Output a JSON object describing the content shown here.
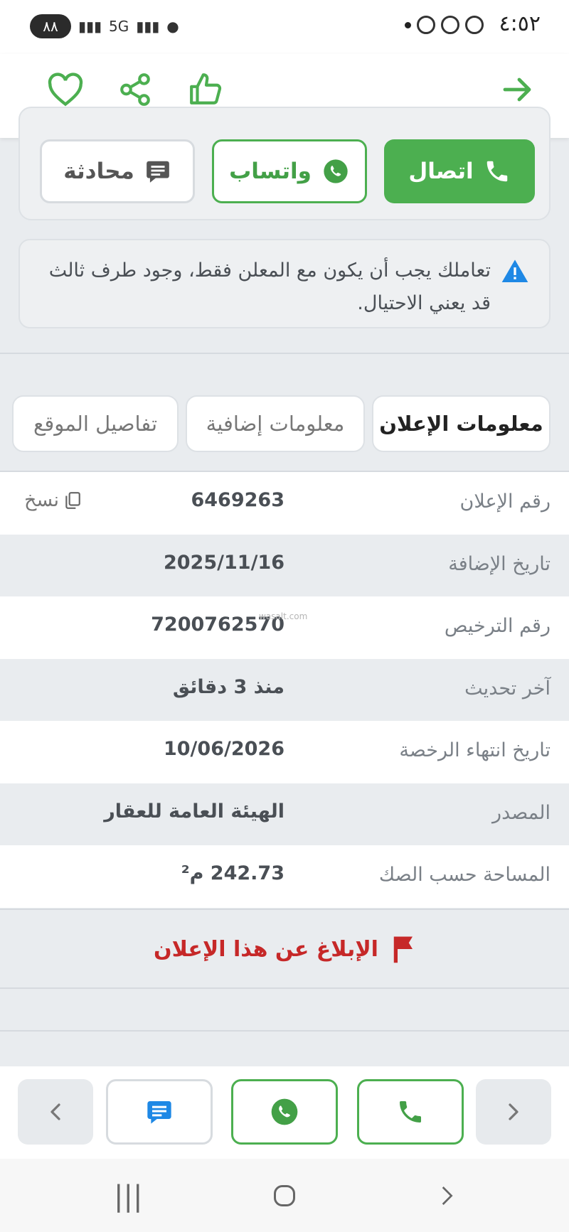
{
  "status_bar": {
    "time": "٤:٥٢",
    "battery": "٨٨",
    "network": "5G"
  },
  "toolbar": {
    "icons": [
      "arrow-right-icon",
      "thumbs-up-icon",
      "share-icon",
      "heart-icon"
    ]
  },
  "contact": {
    "call_label": "اتصال",
    "whatsapp_label": "واتساب",
    "chat_label": "محادثة"
  },
  "warning": {
    "text": "تعاملك يجب أن يكون مع المعلن فقط، وجود طرف ثالث قد يعني الاحتيال."
  },
  "tabs": [
    {
      "label": "معلومات الإعلان",
      "active": true
    },
    {
      "label": "معلومات إضافية",
      "active": false
    },
    {
      "label": "تفاصيل الموقع",
      "active": false
    }
  ],
  "info_rows": [
    {
      "label": "رقم الإعلان",
      "value": "6469263"
    },
    {
      "label": "تاريخ الإضافة",
      "value": "2025/11/16"
    },
    {
      "label": "رقم الترخيص",
      "value": "7200762570"
    },
    {
      "label": "آخر تحديث",
      "value": "منذ 3 دقائق"
    },
    {
      "label": "تاريخ انتهاء الرخصة",
      "value": "10/06/2026"
    },
    {
      "label": "المصدر",
      "value": "الهيئة العامة للعقار"
    },
    {
      "label": "المساحة حسب الصك",
      "value": "242.73 م²"
    }
  ],
  "copy_label": "نسخ",
  "watermark": "wasalt.com",
  "report_label": "الإبلاغ عن هذا الإعلان",
  "colors": {
    "accent_green": "#4caf50",
    "report_red": "#c62828",
    "chat_blue": "#1e88e5",
    "warning_blue": "#1e88e5"
  }
}
